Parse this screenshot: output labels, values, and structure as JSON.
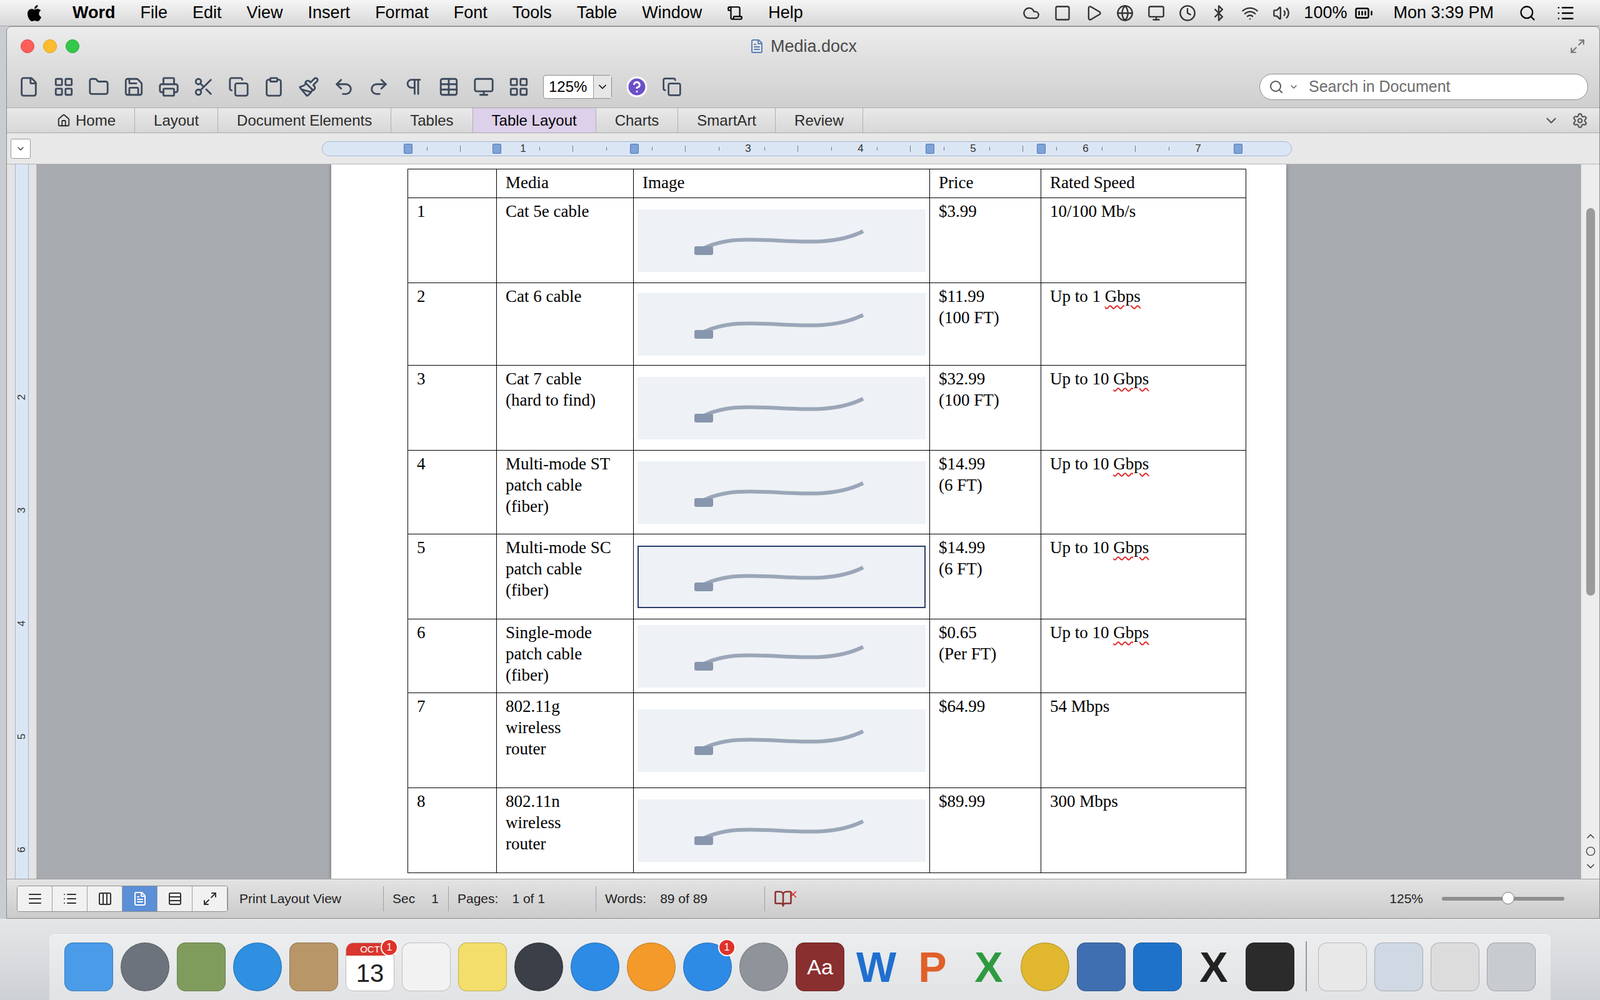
{
  "menu_bar": {
    "app": "Word",
    "items": [
      "File",
      "Edit",
      "View",
      "Insert",
      "Format",
      "Font",
      "Tools",
      "Table",
      "Window",
      "Help"
    ],
    "battery": "100%",
    "clock": "Mon 3:39 PM"
  },
  "window": {
    "title": "Media.docx"
  },
  "toolbar": {
    "zoom": "125%",
    "search_placeholder": "Search in Document"
  },
  "ribbon": {
    "tabs": [
      {
        "label": "Home",
        "selected": false
      },
      {
        "label": "Layout",
        "selected": false
      },
      {
        "label": "Document Elements",
        "selected": false
      },
      {
        "label": "Tables",
        "selected": false
      },
      {
        "label": "Table Layout",
        "selected": true
      },
      {
        "label": "Charts",
        "selected": false
      },
      {
        "label": "SmartArt",
        "selected": false
      },
      {
        "label": "Review",
        "selected": false
      }
    ]
  },
  "ruler": {
    "horizontal": [
      "1",
      "",
      "3",
      "4",
      "5",
      "6",
      "7"
    ],
    "vertical": [
      "",
      "2",
      "3",
      "4",
      "5",
      "6"
    ]
  },
  "table": {
    "columns": [
      "",
      "Media",
      "Image",
      "Price",
      "Rated Speed"
    ],
    "rows": [
      {
        "num": "1",
        "media": [
          "Cat 5e cable"
        ],
        "image_framed": false,
        "price": [
          "$3.99"
        ],
        "speed": [
          {
            "text": "10/100 Mb/s",
            "misspelled": false
          }
        ]
      },
      {
        "num": "2",
        "media": [
          "Cat 6 cable"
        ],
        "image_framed": false,
        "price": [
          "$11.99",
          "(100 FT)"
        ],
        "speed": [
          {
            "text": "Up to 1 ",
            "misspelled": false
          },
          {
            "text": "Gbps",
            "misspelled": true
          }
        ]
      },
      {
        "num": "3",
        "media": [
          "Cat 7 cable",
          "(hard to find)"
        ],
        "image_framed": false,
        "price": [
          "$32.99",
          "(100 FT)"
        ],
        "speed": [
          {
            "text": "Up to 10 ",
            "misspelled": false
          },
          {
            "text": "Gbps",
            "misspelled": true
          }
        ]
      },
      {
        "num": "4",
        "media": [
          "Multi-mode ST",
          "patch cable",
          "(fiber)"
        ],
        "image_framed": false,
        "price": [
          "$14.99",
          "(6 FT)"
        ],
        "speed": [
          {
            "text": "Up to 10 ",
            "misspelled": false
          },
          {
            "text": "Gbps",
            "misspelled": true
          }
        ]
      },
      {
        "num": "5",
        "media": [
          "Multi-mode SC",
          "patch cable",
          "(fiber)"
        ],
        "image_framed": true,
        "price": [
          "$14.99",
          "(6 FT)"
        ],
        "speed": [
          {
            "text": "Up to 10 ",
            "misspelled": false
          },
          {
            "text": "Gbps",
            "misspelled": true
          }
        ]
      },
      {
        "num": "6",
        "media": [
          "Single-mode",
          "patch cable",
          "(fiber)"
        ],
        "image_framed": false,
        "price": [
          "$0.65",
          "(Per FT)"
        ],
        "speed": [
          {
            "text": "Up to 10 ",
            "misspelled": false
          },
          {
            "text": "Gbps",
            "misspelled": true
          }
        ]
      },
      {
        "num": "7",
        "media": [
          "802.11g",
          "wireless",
          "router"
        ],
        "image_framed": false,
        "price": [
          "$64.99"
        ],
        "speed": [
          {
            "text": "54 Mbps",
            "misspelled": false
          }
        ]
      },
      {
        "num": "8",
        "media": [
          "802.11n",
          "wireless",
          "router"
        ],
        "image_framed": false,
        "price": [
          "$89.99"
        ],
        "speed": [
          {
            "text": "300 Mbps",
            "misspelled": false
          }
        ]
      }
    ]
  },
  "status_bar": {
    "views": [
      {
        "selected": false
      },
      {
        "selected": false
      },
      {
        "selected": false
      },
      {
        "selected": true
      },
      {
        "selected": false
      },
      {
        "selected": false
      }
    ],
    "view_name": "Print Layout View",
    "section_label": "Sec",
    "section": "1",
    "pages_label": "Pages:",
    "pages": "1 of 1",
    "words_label": "Words:",
    "words": "89 of 89",
    "zoom": "125%",
    "zoom_level": 0.54
  },
  "dock": {
    "items": [
      {
        "kind": "tile",
        "glyph": "",
        "badge": "",
        "color": "#4a9be8"
      },
      {
        "kind": "round",
        "glyph": "",
        "badge": "",
        "color": "#6d737c"
      },
      {
        "kind": "tile",
        "glyph": "",
        "badge": "",
        "color": "#7f9c5d"
      },
      {
        "kind": "round",
        "glyph": "",
        "badge": "",
        "color": "#2f8fe0"
      },
      {
        "kind": "tile",
        "glyph": "",
        "badge": "",
        "color": "#b89668"
      },
      {
        "kind": "calendar",
        "glyph": "13",
        "month": "OCT",
        "badge": "1",
        "color": "#ffffff"
      },
      {
        "kind": "tile",
        "glyph": "",
        "badge": "",
        "color": "#f2f2f2"
      },
      {
        "kind": "tile",
        "glyph": "",
        "badge": "",
        "color": "#f3dd6b"
      },
      {
        "kind": "round",
        "glyph": "",
        "badge": "",
        "color": "#3a3f48"
      },
      {
        "kind": "round",
        "glyph": "",
        "badge": "",
        "color": "#2d8be6"
      },
      {
        "kind": "round",
        "glyph": "",
        "badge": "",
        "color": "#f39a2b"
      },
      {
        "kind": "round",
        "glyph": "",
        "badge": "1",
        "color": "#2d8be6"
      },
      {
        "kind": "round",
        "glyph": "",
        "badge": "",
        "color": "#8f949b"
      },
      {
        "kind": "tile",
        "glyph": "Aa",
        "badge": "",
        "color": "#8a2f2f"
      },
      {
        "kind": "letter",
        "glyph": "W",
        "badge": "",
        "color": "#1f6fd0"
      },
      {
        "kind": "letter",
        "glyph": "P",
        "badge": "",
        "color": "#e0602a"
      },
      {
        "kind": "letter",
        "glyph": "X",
        "badge": "",
        "color": "#2e9a3f"
      },
      {
        "kind": "round",
        "glyph": "",
        "badge": "",
        "color": "#e0b72f"
      },
      {
        "kind": "tile",
        "glyph": "",
        "badge": "",
        "color": "#3f6fb0"
      },
      {
        "kind": "tile",
        "glyph": "",
        "badge": "",
        "color": "#1f72c9"
      },
      {
        "kind": "letter",
        "glyph": "X",
        "badge": "",
        "color": "#222222"
      },
      {
        "kind": "tile",
        "glyph": "",
        "badge": "",
        "color": "#2b2b2b"
      },
      {
        "kind": "separator",
        "glyph": "",
        "badge": "",
        "color": "#9a9a9a"
      },
      {
        "kind": "tile",
        "glyph": "",
        "badge": "",
        "color": "#e8e8e8"
      },
      {
        "kind": "tile",
        "glyph": "",
        "badge": "",
        "color": "#d0d8e4"
      },
      {
        "kind": "tile",
        "glyph": "",
        "badge": "",
        "color": "#dcdcdc"
      },
      {
        "kind": "tile",
        "glyph": "",
        "badge": "",
        "color": "#c8ccd0"
      }
    ]
  }
}
